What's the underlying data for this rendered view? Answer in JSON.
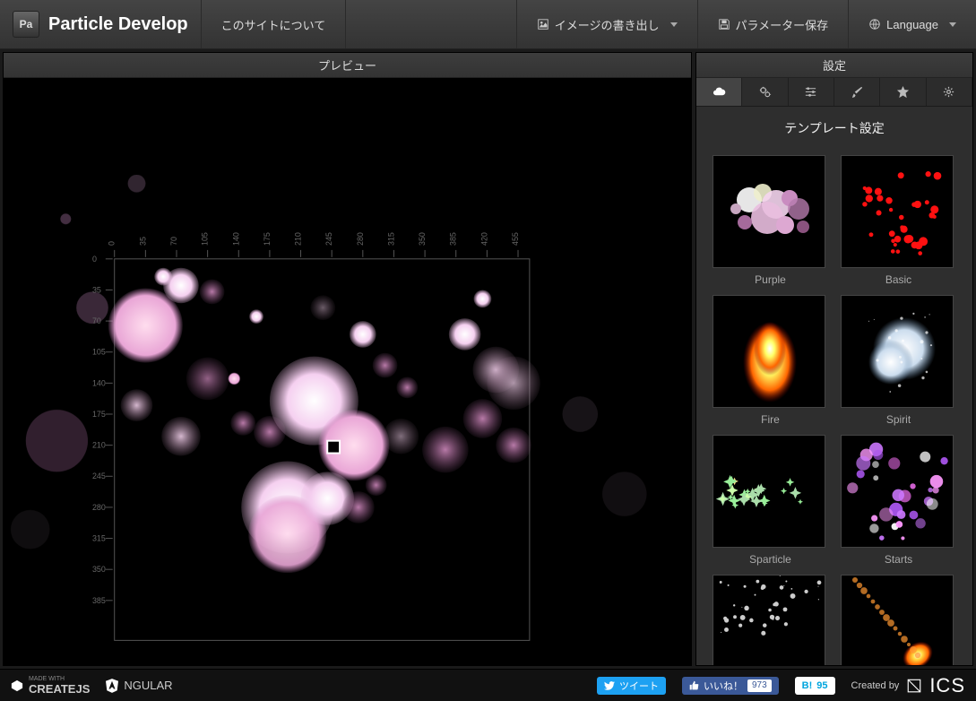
{
  "header": {
    "app_initials": "Pa",
    "app_title": "Particle Develop",
    "about": "このサイトについて",
    "export": "イメージの書き出し",
    "save": "パラメーター保存",
    "language": "Language"
  },
  "panels": {
    "preview_title": "プレビュー",
    "settings_title": "設定",
    "template_section": "テンプレート設定"
  },
  "ruler_ticks": [
    "0",
    "35",
    "70",
    "105",
    "140",
    "175",
    "210",
    "245",
    "280",
    "315",
    "350",
    "385",
    "420",
    "455"
  ],
  "tabs": {
    "cloud": "cloud",
    "cogs": "cogs",
    "sliders": "sliders",
    "brush": "brush",
    "star": "star",
    "gear": "gear"
  },
  "templates": [
    {
      "name": "Purple",
      "type": "purple"
    },
    {
      "name": "Basic",
      "type": "basic"
    },
    {
      "name": "Fire",
      "type": "fire"
    },
    {
      "name": "Spirit",
      "type": "spirit"
    },
    {
      "name": "Sparticle",
      "type": "sparticle"
    },
    {
      "name": "Starts",
      "type": "starts"
    },
    {
      "name": "",
      "type": "blank1"
    },
    {
      "name": "",
      "type": "blank2"
    }
  ],
  "footer": {
    "createjs": "CREATEJS",
    "angular": "NGULAR",
    "tweet": "ツイート",
    "like": "いいね！",
    "like_count": "973",
    "hatebu_prefix": "B!",
    "hatebu_count": "95",
    "created_by": "Created by",
    "ics": "ICS"
  }
}
